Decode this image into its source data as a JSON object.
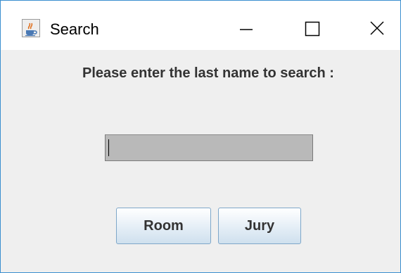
{
  "window": {
    "title": "Search",
    "icons": {
      "app": "java-coffee-cup-icon",
      "minimize": "minimize-icon",
      "maximize": "maximize-icon",
      "close": "close-icon"
    }
  },
  "form": {
    "prompt": "Please enter the last name to search :",
    "search_value": ""
  },
  "buttons": {
    "room_label": "Room",
    "jury_label": "Jury"
  },
  "colors": {
    "window_border": "#3a8fd0",
    "content_background": "#efefef",
    "input_background": "#b9b9b9",
    "button_border": "#7ea7c9"
  }
}
